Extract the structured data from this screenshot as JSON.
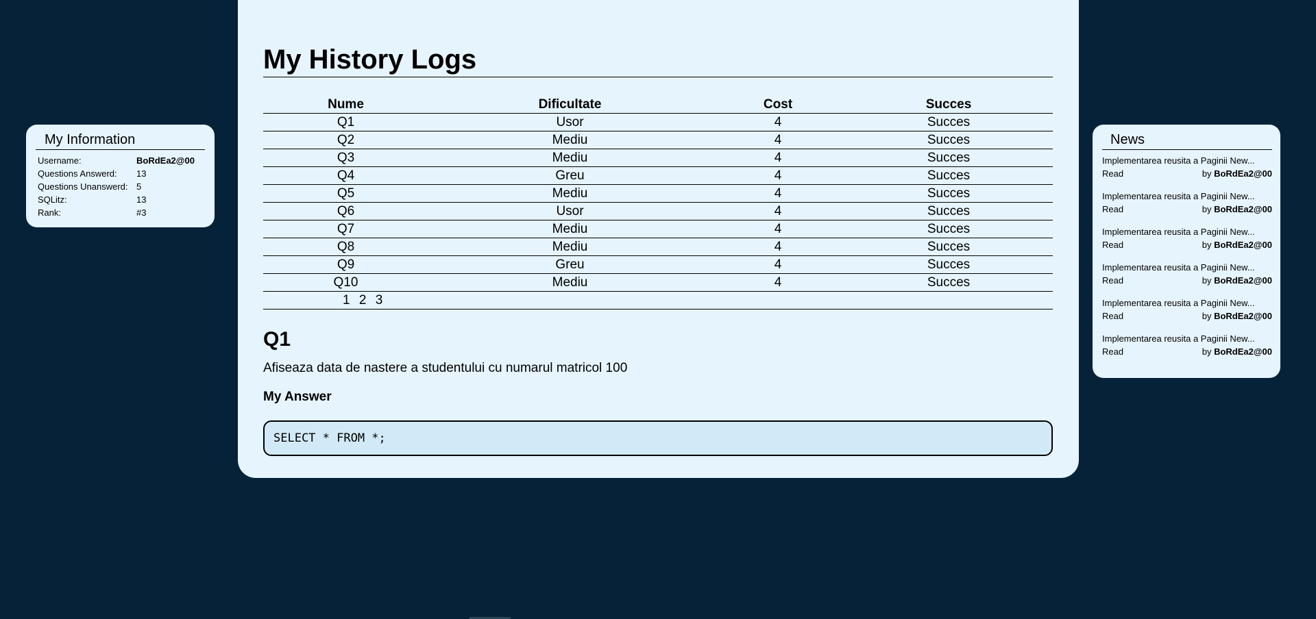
{
  "info": {
    "title": "My Information",
    "rows": [
      {
        "key": "Username:",
        "value": "BoRdEa2@00"
      },
      {
        "key": "Questions Answerd:",
        "value": "13"
      },
      {
        "key": "Questions Unanswerd:",
        "value": "5"
      },
      {
        "key": "SQLitz:",
        "value": "13"
      },
      {
        "key": "Rank:",
        "value": "#3"
      }
    ]
  },
  "main": {
    "title": "My History Logs",
    "headers": {
      "nume": "Nume",
      "dificultate": "Dificultate",
      "cost": "Cost",
      "succes": "Succes"
    },
    "rows": [
      {
        "nume": "Q1",
        "dificultate": "Usor",
        "cost": "4",
        "succes": "Succes"
      },
      {
        "nume": "Q2",
        "dificultate": "Mediu",
        "cost": "4",
        "succes": "Succes"
      },
      {
        "nume": "Q3",
        "dificultate": "Mediu",
        "cost": "4",
        "succes": "Succes"
      },
      {
        "nume": "Q4",
        "dificultate": "Greu",
        "cost": "4",
        "succes": "Succes"
      },
      {
        "nume": "Q5",
        "dificultate": "Mediu",
        "cost": "4",
        "succes": "Succes"
      },
      {
        "nume": "Q6",
        "dificultate": "Usor",
        "cost": "4",
        "succes": "Succes"
      },
      {
        "nume": "Q7",
        "dificultate": "Mediu",
        "cost": "4",
        "succes": "Succes"
      },
      {
        "nume": "Q8",
        "dificultate": "Mediu",
        "cost": "4",
        "succes": "Succes"
      },
      {
        "nume": "Q9",
        "dificultate": "Greu",
        "cost": "4",
        "succes": "Succes"
      },
      {
        "nume": "Q10",
        "dificultate": "Mediu",
        "cost": "4",
        "succes": "Succes"
      }
    ],
    "pages": [
      "1",
      "2",
      "3"
    ],
    "question": {
      "title": "Q1",
      "description": "Afiseaza data de nastere a studentului cu numarul matricol 100",
      "answer_label": "My Answer",
      "answer": "SELECT * FROM *;"
    }
  },
  "news": {
    "title": "News",
    "items": [
      {
        "text": "Implementarea reusita a Paginii New...",
        "read": "Read",
        "by": "by ",
        "author": "BoRdEa2@00"
      },
      {
        "text": "Implementarea reusita a Paginii New...",
        "read": "Read",
        "by": "by ",
        "author": "BoRdEa2@00"
      },
      {
        "text": "Implementarea reusita a Paginii New...",
        "read": "Read",
        "by": "by ",
        "author": "BoRdEa2@00"
      },
      {
        "text": "Implementarea reusita a Paginii New...",
        "read": "Read",
        "by": "by ",
        "author": "BoRdEa2@00"
      },
      {
        "text": "Implementarea reusita a Paginii New...",
        "read": "Read",
        "by": "by ",
        "author": "BoRdEa2@00"
      },
      {
        "text": "Implementarea reusita a Paginii New...",
        "read": "Read",
        "by": "by ",
        "author": "BoRdEa2@00"
      }
    ]
  },
  "colors": {
    "background": "#062238",
    "panel": "#e6f4fd",
    "answer_box": "#d2eaf8"
  }
}
